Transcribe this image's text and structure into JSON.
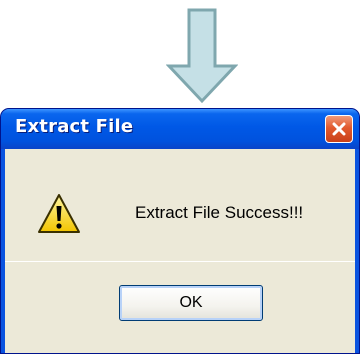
{
  "dialog": {
    "title": "Extract File",
    "message": "Extract File Success!!!",
    "ok_label": "OK",
    "icon": "warning-icon"
  },
  "decor": {
    "arrow_icon": "down-arrow-icon"
  },
  "colors": {
    "titlebar": "#0058e6",
    "client": "#ece9d8",
    "close": "#e25a2e",
    "arrow_fill": "#c5e0e6",
    "arrow_stroke": "#7fa7ae"
  }
}
